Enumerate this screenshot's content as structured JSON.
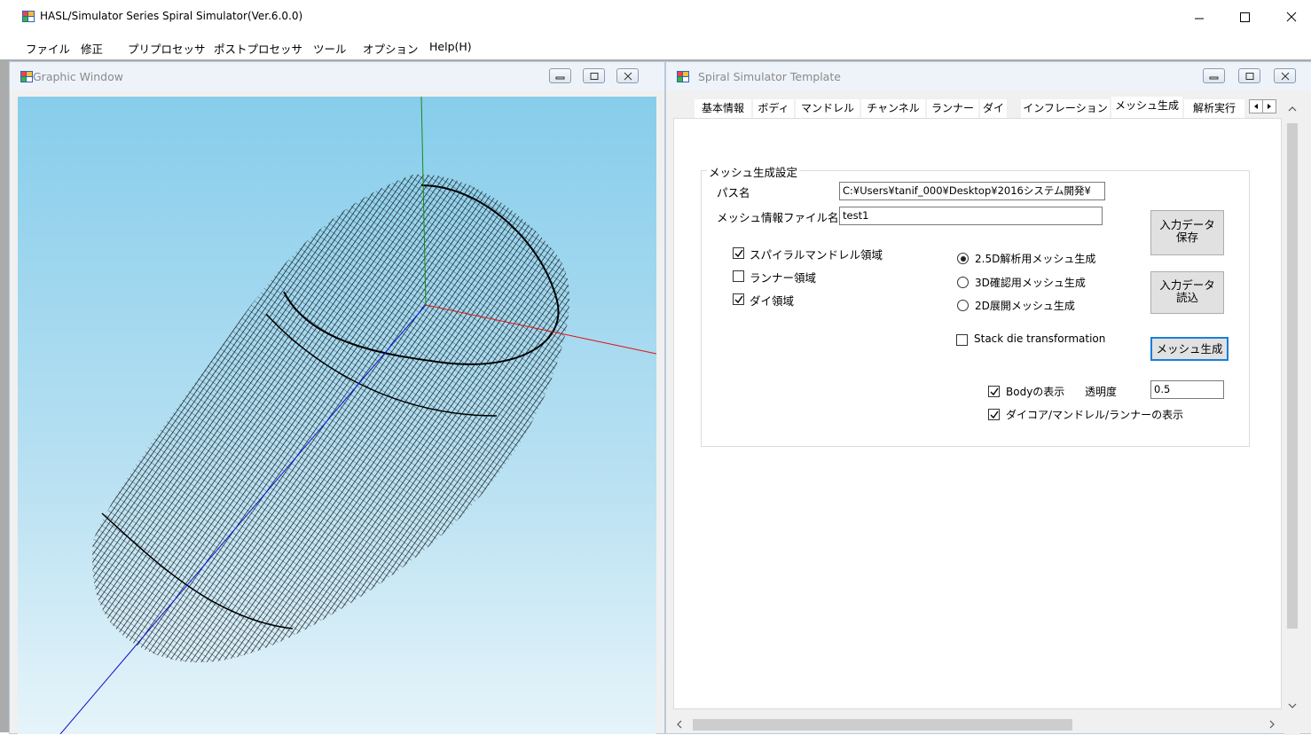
{
  "app": {
    "title": "HASL/Simulator Series Spiral Simulator(Ver.6.0.0)"
  },
  "menu": [
    "ファイル",
    "修正",
    "プリプロセッサ",
    "ポストプロセッサ",
    "ツール",
    "オプション",
    "Help(H)"
  ],
  "graphic_window": {
    "title": "Graphic Window"
  },
  "template_window": {
    "title": "Spiral Simulator Template",
    "tabs": [
      "基本情報",
      "ボディ",
      "マンドレル",
      "チャンネル",
      "ランナー",
      "ダイ",
      "インフレーション",
      "メッシュ生成",
      "解析実行"
    ],
    "active_tab": "メッシュ生成",
    "group_title": "メッシュ生成設定",
    "path_label": "パス名",
    "path_value": "C:¥Users¥tanif_000¥Desktop¥2016システム開発¥",
    "mesh_file_label": "メッシュ情報ファイル名",
    "mesh_file_value": "test1",
    "checkboxes": {
      "spiral_mandrel": {
        "label": "スパイラルマンドレル領域",
        "checked": true
      },
      "runner": {
        "label": "ランナー領域",
        "checked": false
      },
      "die": {
        "label": "ダイ領域",
        "checked": true
      }
    },
    "radios": [
      {
        "label": "2.5D解析用メッシュ生成",
        "selected": true
      },
      {
        "label": "3D確認用メッシュ生成",
        "selected": false
      },
      {
        "label": "2D展開メッシュ生成",
        "selected": false
      }
    ],
    "stack_die": {
      "label": "Stack die transformation",
      "checked": false
    },
    "buttons": {
      "save_line1": "入力データ",
      "save_line2": "保存",
      "load_line1": "入力データ",
      "load_line2": "読込",
      "generate": "メッシュ生成"
    },
    "body_display": {
      "label": "Bodyの表示",
      "checked": true
    },
    "transparency_label": "透明度",
    "transparency_value": "0.5",
    "core_display": {
      "label": "ダイコア/マンドレル/ランナーの表示",
      "checked": true
    }
  }
}
